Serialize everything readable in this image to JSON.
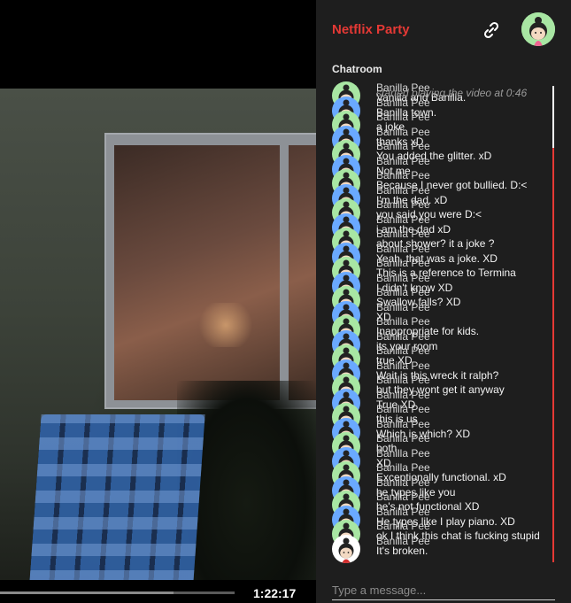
{
  "player": {
    "time": "1:22:17",
    "progress": 0.74
  },
  "header": {
    "brand": "Netflix Party",
    "link_icon": "link-icon",
    "user_avatar": "user-avatar-icon"
  },
  "chat": {
    "title": "Chatroom",
    "system_message": "started playing the video at 0:46",
    "composer_placeholder": "Type a message...",
    "messages": [
      {
        "name": "Banilla Pee",
        "text": "Vanilla and Banilla.",
        "avatar": "green"
      },
      {
        "name": "Banilla Pee",
        "text": "Banilla town.",
        "avatar": "blue"
      },
      {
        "name": "Banilla Pee",
        "text": "a joke",
        "avatar": "green"
      },
      {
        "name": "Banilla Pee",
        "text": "thanks xD",
        "avatar": "blue"
      },
      {
        "name": "Banilla Pee",
        "text": "You added the glitter. xD",
        "avatar": "green"
      },
      {
        "name": "Banilla Pee",
        "text": "Not me",
        "avatar": "blue"
      },
      {
        "name": "Banilla Pee",
        "text": "Because I never got bullied. D:<",
        "avatar": "green"
      },
      {
        "name": "Banilla Pee",
        "text": "I'm the dad. xD",
        "avatar": "blue"
      },
      {
        "name": "Banilla Pee",
        "text": "you said you were D:<",
        "avatar": "green"
      },
      {
        "name": "Banilla Pee",
        "text": "i am the dad xD",
        "avatar": "blue"
      },
      {
        "name": "Banilla Pee",
        "text": "about shower? it a joke ?",
        "avatar": "green"
      },
      {
        "name": "Banilla Pee",
        "text": "Yeah, that was a joke. XD",
        "avatar": "blue"
      },
      {
        "name": "Banilla Pee",
        "text": "This is a reference to Termina",
        "avatar": "green"
      },
      {
        "name": "Banilla Pee",
        "text": "I didn't know XD",
        "avatar": "blue"
      },
      {
        "name": "Banilla Pee",
        "text": "Swallow falls? XD",
        "avatar": "green"
      },
      {
        "name": "Banilla Pee",
        "text": "XD",
        "avatar": "blue"
      },
      {
        "name": "Banilla Pee",
        "text": "Inappropriate for kids.",
        "avatar": "green"
      },
      {
        "name": "Banilla Pee",
        "text": "its your room",
        "avatar": "blue"
      },
      {
        "name": "Banilla Pee",
        "text": "true XD",
        "avatar": "green"
      },
      {
        "name": "Banilla Pee",
        "text": "Wait is this wreck it ralph?",
        "avatar": "blue"
      },
      {
        "name": "Banilla Pee",
        "text": "but they wont get it anyway",
        "avatar": "green"
      },
      {
        "name": "Banilla Pee",
        "text": "True XD",
        "avatar": "blue"
      },
      {
        "name": "Banilla Pee",
        "text": "this is us",
        "avatar": "green"
      },
      {
        "name": "Banilla Pee",
        "text": "Which is which? XD",
        "avatar": "blue"
      },
      {
        "name": "Banilla Pee",
        "text": "both",
        "avatar": "green"
      },
      {
        "name": "Banilla Pee",
        "text": "XD",
        "avatar": "blue"
      },
      {
        "name": "Banilla Pee",
        "text": "Exceptionally functional. xD",
        "avatar": "green"
      },
      {
        "name": "Banilla Pee",
        "text": "he types like you",
        "avatar": "blue"
      },
      {
        "name": "Banilla Pee",
        "text": "he's not functional XD",
        "avatar": "green"
      },
      {
        "name": "Banilla Pee",
        "text": "He types like I play piano. XD",
        "avatar": "blue"
      },
      {
        "name": "Banilla Pee",
        "text": "ok I think this chat is fucking stupid",
        "avatar": "green"
      },
      {
        "name": "Banilla Pee",
        "text": "It's broken.",
        "avatar": "dark"
      }
    ]
  },
  "colors": {
    "brand": "#e53935",
    "panel_bg": "#1e1e1e",
    "avatar_green": "#a8e6a3",
    "avatar_blue": "#6aa9ff"
  }
}
